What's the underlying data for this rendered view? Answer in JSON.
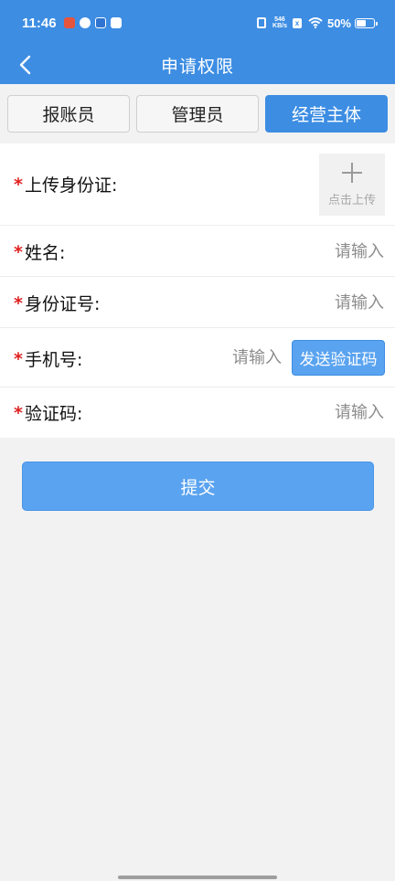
{
  "status_bar": {
    "time": "11:46",
    "net_speed_value": "546",
    "net_speed_unit": "KB/s",
    "battery": "50%"
  },
  "header": {
    "title": "申请权限"
  },
  "tabs": [
    {
      "label": "报账员",
      "active": false
    },
    {
      "label": "管理员",
      "active": false
    },
    {
      "label": "经营主体",
      "active": true
    }
  ],
  "form": {
    "required_mark": "*",
    "upload": {
      "label": "上传身份证:",
      "button_text": "点击上传"
    },
    "name": {
      "label": "姓名:",
      "placeholder": "请输入",
      "value": ""
    },
    "id_number": {
      "label": "身份证号:",
      "placeholder": "请输入",
      "value": ""
    },
    "phone": {
      "label": "手机号:",
      "placeholder": "请输入",
      "value": "",
      "send_code_label": "发送验证码"
    },
    "code": {
      "label": "验证码:",
      "placeholder": "请输入",
      "value": ""
    }
  },
  "submit_label": "提交",
  "colors": {
    "primary": "#3d8de3",
    "button": "#5aa3f0",
    "required": "#e02020",
    "background": "#f2f2f2"
  }
}
